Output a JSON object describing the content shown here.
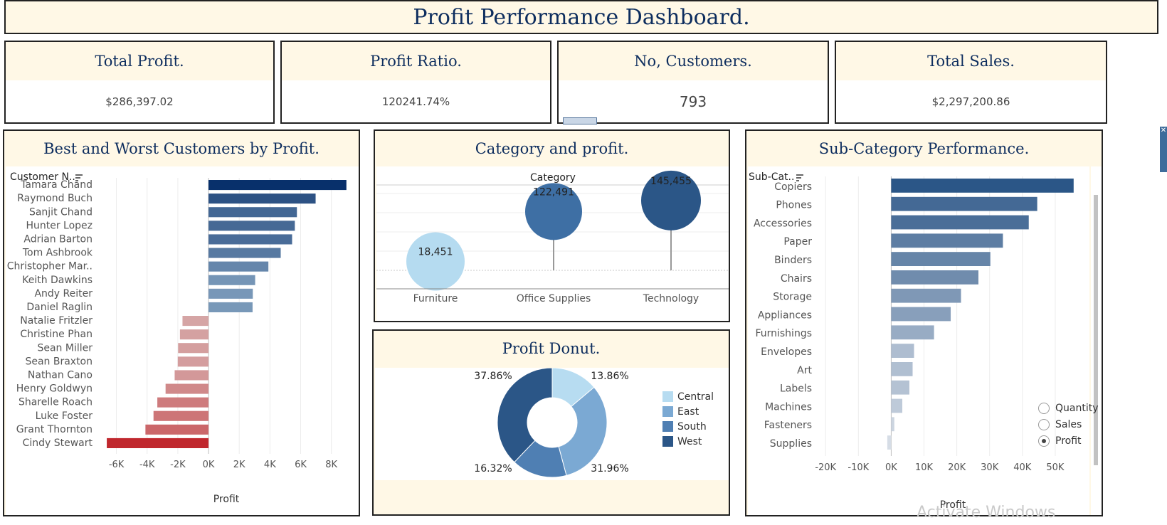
{
  "dashboard": {
    "title": "Profit Performance Dashboard."
  },
  "kpis": [
    {
      "label": "Total Profit.",
      "value": "$286,397.02"
    },
    {
      "label": "Profit Ratio.",
      "value": "120241.74%"
    },
    {
      "label": "No, Customers.",
      "value": "793"
    },
    {
      "label": "Total Sales.",
      "value": "$2,297,200.86"
    }
  ],
  "customers_panel": {
    "title": "Best and Worst Customers by Profit.",
    "column_header": "Customer N..",
    "sort_icon": "sort-icon"
  },
  "category_panel": {
    "title": "Category and profit.",
    "header": "Category"
  },
  "donut_panel": {
    "title": "Profit Donut."
  },
  "subcat_panel": {
    "title": "Sub-Category Performance.",
    "column_header": "Sub-Cat..",
    "sort_icon": "sort-icon"
  },
  "measure_selector": {
    "options": [
      "Quantity",
      "Sales",
      "Profit"
    ],
    "selected": "Profit"
  },
  "watermark": "Activate Windows",
  "chart_data": [
    {
      "type": "bar",
      "orientation": "horizontal",
      "categories": [
        "Tamara Chand",
        "Raymond Buch",
        "Sanjit Chand",
        "Hunter Lopez",
        "Adrian Barton",
        "Tom Ashbrook",
        "Christopher Mar..",
        "Keith Dawkins",
        "Andy Reiter",
        "Daniel Raglin",
        "Natalie Fritzler",
        "Christine Phan",
        "Sean Miller",
        "Sean Braxton",
        "Nathan Cano",
        "Henry Goldwyn",
        "Sharelle Roach",
        "Luke Foster",
        "Grant Thornton",
        "Cindy Stewart"
      ],
      "values": [
        8981,
        6976,
        5757,
        5622,
        5444,
        4703,
        3900,
        3038,
        2885,
        2869,
        -1695,
        -1862,
        -1981,
        -2004,
        -2205,
        -2797,
        -3334,
        -3583,
        -4109,
        -6626
      ],
      "xlabel": "Profit",
      "xlim": [
        -7000,
        9500
      ],
      "ticks": [
        -6000,
        -4000,
        -2000,
        0,
        2000,
        4000,
        6000,
        8000
      ],
      "tick_labels": [
        "-6K",
        "-4K",
        "-2K",
        "0K",
        "2K",
        "4K",
        "6K",
        "8K"
      ],
      "colors": {
        "positive_max": "#08306b",
        "positive_min": "#7f9ebd",
        "negative_min": "#d6aaaa",
        "negative_max": "#c0272d"
      }
    },
    {
      "type": "scatter",
      "subtype": "lollipop",
      "categories": [
        "Furniture",
        "Office Supplies",
        "Technology"
      ],
      "values": [
        18451,
        122491,
        145455
      ],
      "labels": [
        "18,451",
        "122,491",
        "145,455"
      ],
      "xlabel": "Category",
      "colors": [
        "#b5dbf0",
        "#3e6fa4",
        "#2b5687"
      ]
    },
    {
      "type": "pie",
      "subtype": "donut",
      "categories": [
        "Central",
        "East",
        "South",
        "West"
      ],
      "values": [
        13.86,
        31.96,
        16.32,
        37.86
      ],
      "labels": [
        "13.86%",
        "31.96%",
        "16.32%",
        "37.86%"
      ],
      "colors": [
        "#b7dcf1",
        "#7ba9d3",
        "#4f7fb3",
        "#2b5687"
      ],
      "legend": "right"
    },
    {
      "type": "bar",
      "orientation": "horizontal",
      "categories": [
        "Copiers",
        "Phones",
        "Accessories",
        "Paper",
        "Binders",
        "Chairs",
        "Storage",
        "Appliances",
        "Furnishings",
        "Envelopes",
        "Art",
        "Labels",
        "Machines",
        "Fasteners",
        "Supplies"
      ],
      "values": [
        55618,
        44516,
        41937,
        34054,
        30222,
        26590,
        21279,
        18138,
        13059,
        6964,
        6528,
        5546,
        3385,
        950,
        -1189
      ],
      "xlabel": "Profit",
      "xlim": [
        -22000,
        60000
      ],
      "ticks": [
        -20000,
        -10000,
        0,
        10000,
        20000,
        30000,
        40000,
        50000
      ],
      "tick_labels": [
        "-20K",
        "-10K",
        "0K",
        "10K",
        "20K",
        "30K",
        "40K",
        "50K"
      ],
      "colors": {
        "max": "#2b5687",
        "min": "#d6dde6"
      }
    }
  ]
}
